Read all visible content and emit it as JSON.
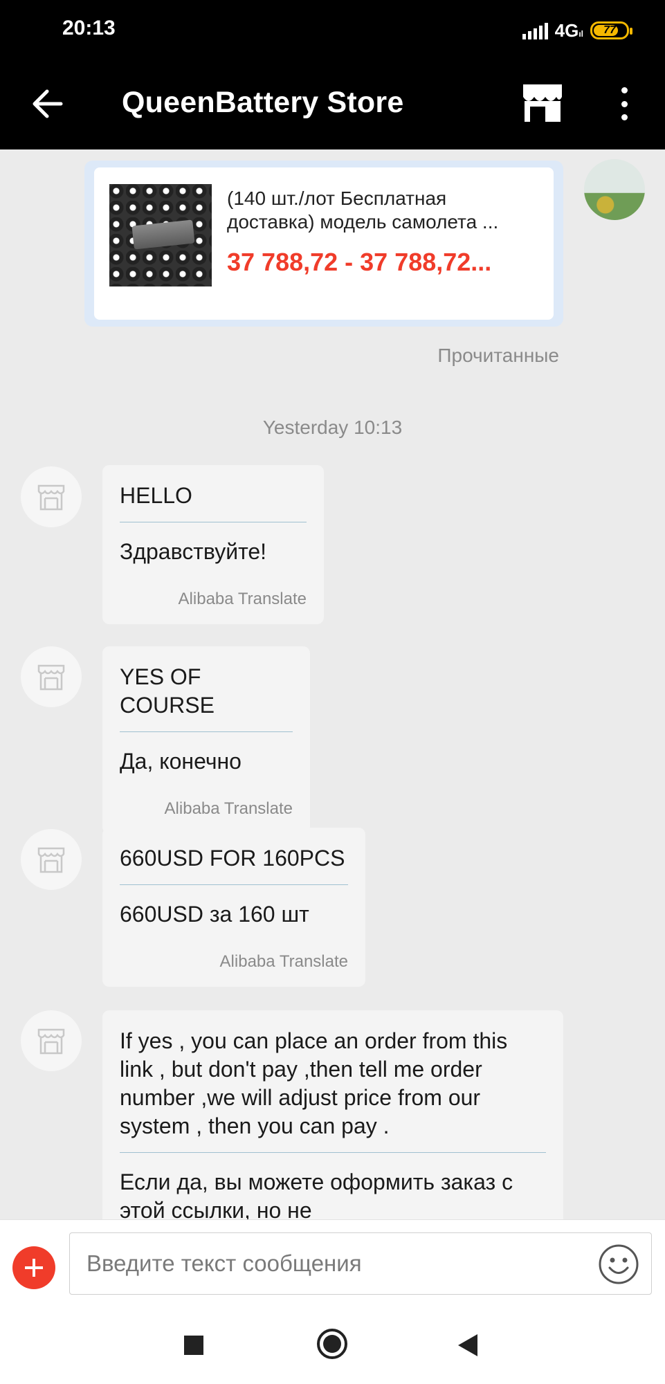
{
  "status_bar": {
    "time": "20:13",
    "network": "4G",
    "battery": "77",
    "battery_level_pct": 77
  },
  "header": {
    "title": "QueenBattery Store",
    "back_icon": "arrow-left-icon",
    "store_icon": "store-icon",
    "menu_icon": "more-vert-icon"
  },
  "product": {
    "title": "(140 шт./лот Бесплатная доставка) модель самолета ...",
    "price": "37 788,72 - 37 788,72...",
    "read_status": "Прочитанные"
  },
  "day_separator": "Yesterday 10:13",
  "messages": [
    {
      "original": "HELLO",
      "translation": "Здравствуйте!",
      "credit": "Alibaba Translate"
    },
    {
      "original": "YES OF COURSE",
      "translation": "Да, конечно",
      "credit": "Alibaba Translate"
    },
    {
      "original": "660USD FOR 160PCS",
      "translation": "660USD за 160 шт",
      "credit": "Alibaba Translate"
    },
    {
      "original": "If yes , you can place an order from this link , but don't pay ,then tell me order number ,we will adjust price from our system , then you can pay .",
      "translation": "Если да, вы можете оформить заказ с этой ссылки, но не"
    }
  ],
  "composer": {
    "placeholder": "Введите текст сообщения",
    "add_icon": "plus-icon",
    "emoji_icon": "smiley-icon"
  },
  "colors": {
    "accent": "#f03c2a",
    "header_bg": "#000000",
    "chat_bg": "#ebebeb",
    "bubble_bg": "#f4f4f4"
  }
}
